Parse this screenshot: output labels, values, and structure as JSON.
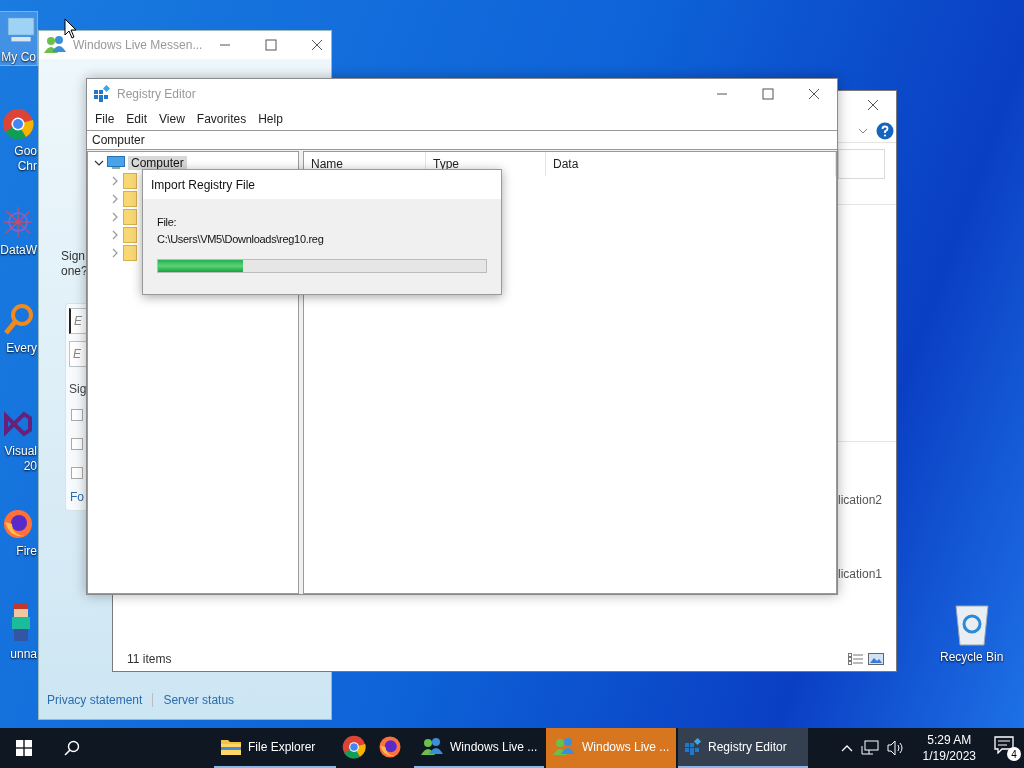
{
  "desktop_icons": [
    {
      "kind": "computer",
      "lines": [
        "My Co"
      ],
      "selected": true
    },
    {
      "kind": "chrome",
      "lines": [
        "Goo",
        "Chr"
      ],
      "selected": false
    },
    {
      "kind": "network",
      "lines": [
        "DataW"
      ],
      "selected": false
    },
    {
      "kind": "magnifier",
      "lines": [
        "Every"
      ],
      "selected": false
    },
    {
      "kind": "studio",
      "lines": [
        "Visual",
        "20"
      ],
      "selected": false
    },
    {
      "kind": "firefox",
      "lines": [
        "Fire"
      ],
      "selected": false
    },
    {
      "kind": "figure",
      "lines": [
        "unna"
      ],
      "selected": false
    }
  ],
  "recycle_bin": {
    "label": "Recycle Bin"
  },
  "messenger": {
    "title": "Windows Live Messen...",
    "prompt_lines": [
      "Sign",
      "one?"
    ],
    "fields": [
      {
        "placeholder": "E",
        "focused": true
      },
      {
        "placeholder": "E",
        "focused": false
      }
    ],
    "status_label": "Sig",
    "checkboxes": [
      {
        "checked": false
      },
      {
        "checked": false
      },
      {
        "checked": false
      }
    ],
    "link": "Fo",
    "footer_links": [
      "Privacy statement",
      "Server status"
    ]
  },
  "explorer": {
    "items": [
      "lication2",
      "lication1"
    ],
    "status": "11 items"
  },
  "registry": {
    "title": "Registry Editor",
    "menu": [
      "File",
      "Edit",
      "View",
      "Favorites",
      "Help"
    ],
    "address": "Computer",
    "tree": {
      "label": "Computer",
      "expanded": true,
      "selected": true,
      "children": [
        {
          "expanded": false
        },
        {
          "expanded": false
        },
        {
          "expanded": false
        },
        {
          "expanded": false
        },
        {
          "expanded": false
        }
      ]
    },
    "columns": [
      "Name",
      "Type",
      "Data"
    ]
  },
  "dialog": {
    "title": "Import Registry File",
    "file_label": "File:",
    "file_path": "C:\\Users\\VM5\\Downloads\\reg10.reg",
    "level": 0.26
  },
  "taskbar": {
    "items": [
      {
        "kind": "folder",
        "label": "File Explorer",
        "running": true,
        "flashing": false,
        "selected": false
      },
      {
        "kind": "chrome",
        "running": false,
        "flashing": false,
        "selected": false
      },
      {
        "kind": "firefox",
        "running": false,
        "flashing": false,
        "selected": false
      },
      {
        "kind": "messenger",
        "label": "Windows Live ...",
        "running": true,
        "flashing": false,
        "selected": false
      },
      {
        "kind": "messenger",
        "label": "Windows Live ...",
        "running": true,
        "flashing": true,
        "selected": false
      },
      {
        "kind": "registry",
        "label": "Registry Editor",
        "running": true,
        "flashing": false,
        "selected": true
      }
    ],
    "time": "5:29 AM",
    "date": "1/19/2023",
    "notifications": "4"
  }
}
